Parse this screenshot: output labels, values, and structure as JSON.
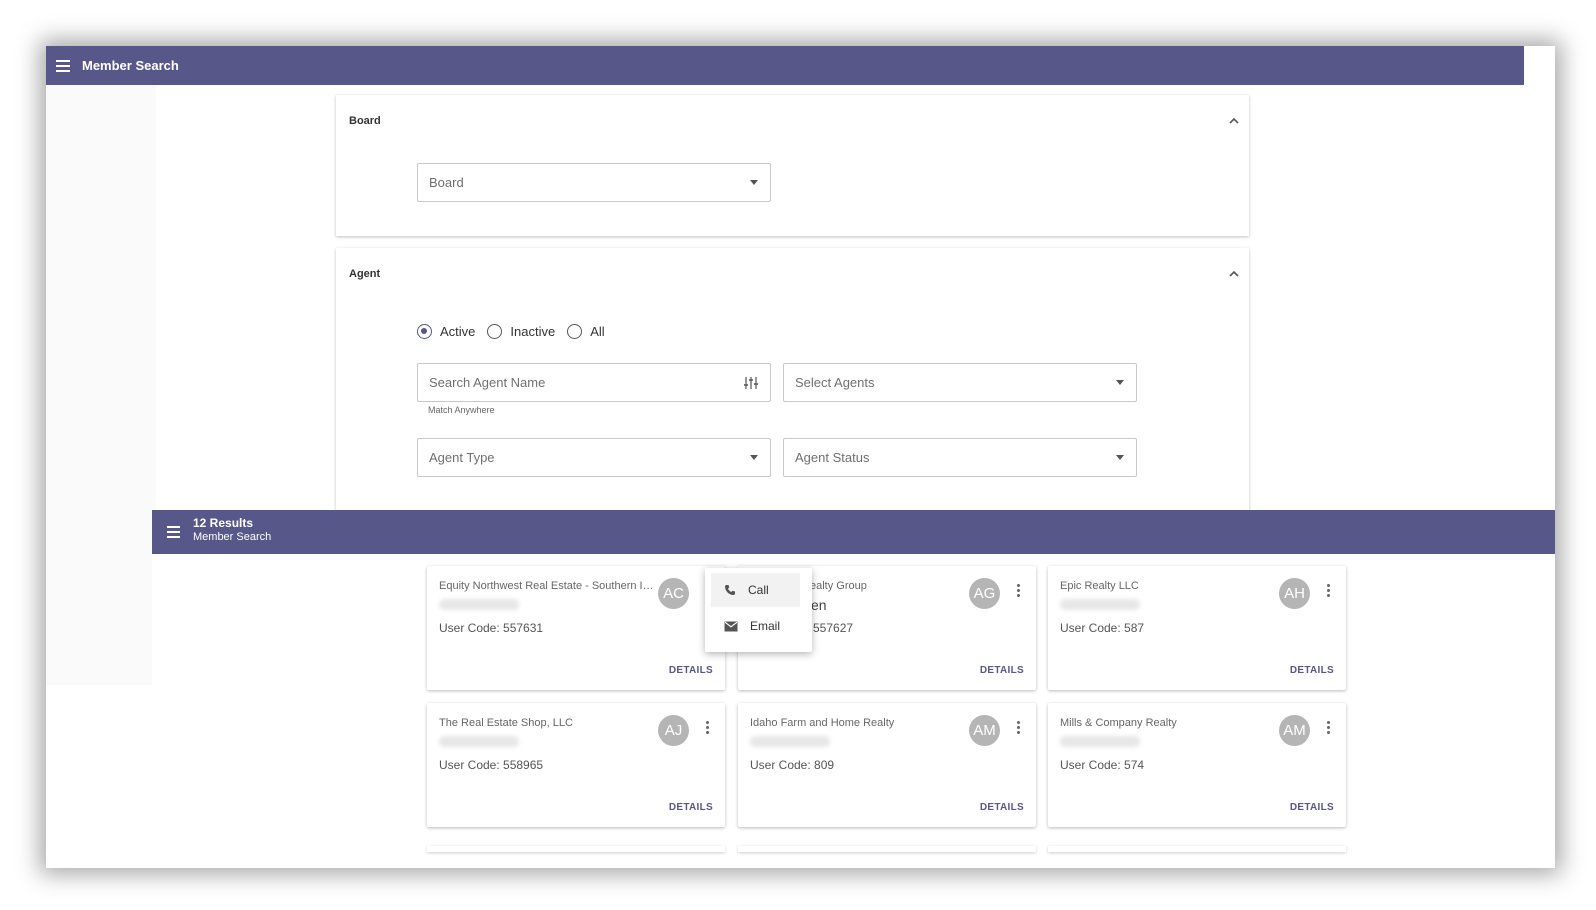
{
  "topbar": {
    "title": "Member Search"
  },
  "board_panel": {
    "title": "Board",
    "board_select": {
      "value": "Board"
    }
  },
  "agent_panel": {
    "title": "Agent",
    "radios": [
      {
        "label": "Active",
        "checked": true
      },
      {
        "label": "Inactive",
        "checked": false
      },
      {
        "label": "All",
        "checked": false
      }
    ],
    "search_placeholder": "Search Agent Name",
    "search_hint": "Match Anywhere",
    "select_agents": "Select Agents",
    "agent_type": "Agent Type",
    "agent_status": "Agent Status"
  },
  "results": {
    "count_label": "12 Results",
    "subtitle": "Member Search",
    "details_label": "DETAILS",
    "cards": [
      {
        "office": "Equity Northwest Real Estate - Southern Id...",
        "initials": "AC",
        "user_code": "User Code: 557631"
      },
      {
        "office": "ealty Group",
        "initials": "AG",
        "user_code": "557627",
        "partial_name": "en"
      },
      {
        "office": "Epic Realty LLC",
        "initials": "AH",
        "user_code": "User Code: 587"
      },
      {
        "office": "The Real Estate Shop, LLC",
        "initials": "AJ",
        "user_code": "User Code: 558965"
      },
      {
        "office": "Idaho Farm and Home Realty",
        "initials": "AM",
        "user_code": "User Code: 809"
      },
      {
        "office": "Mills & Company Realty",
        "initials": "AM",
        "user_code": "User Code: 574"
      }
    ]
  },
  "context_menu": {
    "call": "Call",
    "email": "Email"
  },
  "colors": {
    "primary": "#575789",
    "avatar": "#b5b5b5"
  }
}
